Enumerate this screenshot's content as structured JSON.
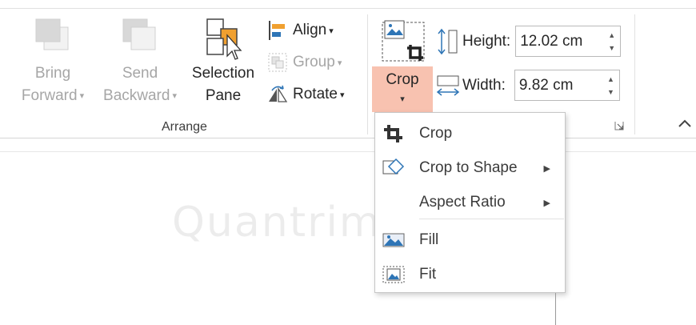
{
  "arrange": {
    "group_label": "Arrange",
    "bring_forward": {
      "line1": "Bring",
      "line2": "Forward",
      "enabled": false
    },
    "send_backward": {
      "line1": "Send",
      "line2": "Backward",
      "enabled": false
    },
    "selection_pane": {
      "line1": "Selection",
      "line2": "Pane"
    },
    "align": {
      "label": "Align"
    },
    "group": {
      "label": "Group",
      "enabled": false
    },
    "rotate": {
      "label": "Rotate"
    }
  },
  "size": {
    "crop": {
      "label": "Crop"
    },
    "height": {
      "label": "Height:",
      "value": "12.02 cm"
    },
    "width": {
      "label": "Width:",
      "value": "9.82 cm"
    }
  },
  "crop_menu": {
    "items": [
      {
        "label": "Crop",
        "icon": "crop-icon",
        "submenu": false
      },
      {
        "label": "Crop to Shape",
        "icon": "crop-to-shape-icon",
        "submenu": true
      },
      {
        "label": "Aspect Ratio",
        "icon": "",
        "submenu": true
      },
      {
        "label": "Fill",
        "icon": "fill-icon",
        "submenu": false
      },
      {
        "label": "Fit",
        "icon": "fit-icon",
        "submenu": false
      }
    ]
  },
  "watermark": "Quantrimang",
  "colors": {
    "crop_button_active": "#f8c2b0",
    "disabled_text": "#a6a6a6",
    "accent_blue": "#2e75b6",
    "accent_orange": "#f0a030"
  }
}
